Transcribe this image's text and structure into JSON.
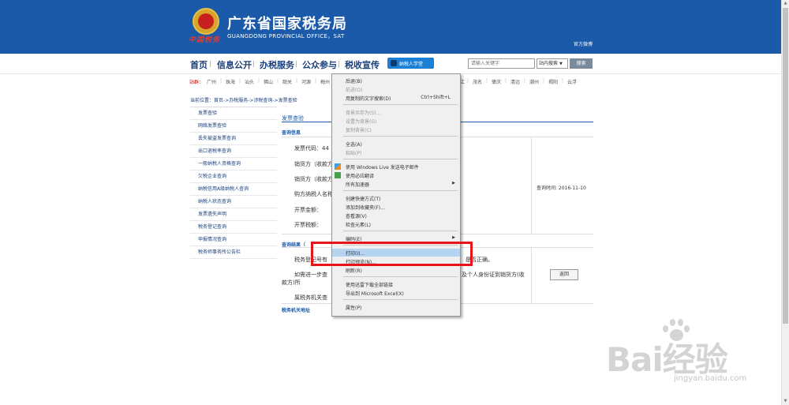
{
  "header": {
    "title": "广东省国家税务局",
    "subtitle": "GUANGDONG PROVINCIAL OFFICE，SAT",
    "logo_script": "中国税务",
    "weibo_link": "官方微博",
    "bg_color": "#1a5aa8"
  },
  "nav": {
    "items": [
      "首页",
      "信息公开",
      "办税服务",
      "公众参与",
      "税收宣传"
    ],
    "learn_button": "纳税人学堂"
  },
  "search": {
    "placeholder": "请输入关键字",
    "scope": "站内搜索",
    "button": "搜索"
  },
  "city_bar": {
    "label": "站群：",
    "cities_left": [
      "广州",
      "珠海",
      "汕头",
      "佛山",
      "韶关",
      "河源",
      "梅州"
    ],
    "cities_right": [
      "江",
      "茂名",
      "肇庆",
      "清远",
      "潮州",
      "揭阳",
      "云浮"
    ]
  },
  "breadcrumb": "当前位置：首页->办税服务->涉税查询->发票查验",
  "sidebar": {
    "items": [
      "发票查验",
      "网络发票查验",
      "丢失被盗发票查询",
      "出口退税率查询",
      "一般纳税人资格查询",
      "欠税企业查询",
      "纳税信用A级纳税人查询",
      "纳税人状态查询",
      "发票遗失声明",
      "税务登记查询",
      "申报情况查询",
      "税务师事务所公告栏"
    ]
  },
  "content": {
    "title": "发票查验",
    "query_info_label": "查询信息",
    "fields": [
      "发票代码：44",
      "销货方（收款方",
      "销货方（收款方",
      "购方纳税人名称",
      "开票金额：",
      "开票税额："
    ],
    "query_time": "查询时间: 2016-11-10",
    "result_label": "查询结果（",
    "result_texts": [
      "税务登记号有",
      "是否正确。",
      "如需进一步查",
      "及个人身份证到销货方(收",
      "款方)所",
      "属税务机关查"
    ],
    "back_button": "返回",
    "tax_office_label": "税务机关地址"
  },
  "context_menu": {
    "items": [
      {
        "label": "后退(B)",
        "disabled": false
      },
      {
        "label": "前进(O)",
        "disabled": true
      },
      {
        "label": "用复制的文字搜索(D)",
        "shortcut": "Ctrl+Shift+L",
        "disabled": false
      },
      {
        "label": "背景另存为(S)...",
        "disabled": true
      },
      {
        "label": "设置为背景(G)",
        "disabled": true
      },
      {
        "label": "复制背景(C)",
        "disabled": true
      },
      {
        "label": "全选(A)",
        "disabled": false
      },
      {
        "label": "粘贴(P)",
        "disabled": true
      },
      {
        "label": "使用 Windows Live 发送电子邮件",
        "disabled": false,
        "icon": "windows-live-icon"
      },
      {
        "label": "使用必应翻译",
        "disabled": false,
        "icon": "translate-icon"
      },
      {
        "label": "所有加速器",
        "disabled": false,
        "submenu": true
      },
      {
        "label": "创建快捷方式(T)",
        "disabled": false
      },
      {
        "label": "添加到收藏夹(F)...",
        "disabled": false
      },
      {
        "label": "查看源(V)",
        "disabled": false
      },
      {
        "label": "检查元素(L)",
        "disabled": false
      },
      {
        "label": "编码(E)",
        "disabled": false,
        "submenu": true
      },
      {
        "label": "打印(I)...",
        "disabled": false,
        "highlighted": true
      },
      {
        "label": "打印预览(N)...",
        "disabled": false
      },
      {
        "label": "刷新(R)",
        "disabled": false
      },
      {
        "label": "使用迅雷下载全部链接",
        "disabled": false
      },
      {
        "label": "导出到 Microsoft Excel(X)",
        "disabled": false
      },
      {
        "label": "属性(P)",
        "disabled": false
      }
    ],
    "highlight_color": "#b4d4f1"
  },
  "annotation": {
    "color": "#e8131b"
  },
  "watermark": {
    "text": "Bai经验",
    "url": "jingyan.baidu.com"
  }
}
